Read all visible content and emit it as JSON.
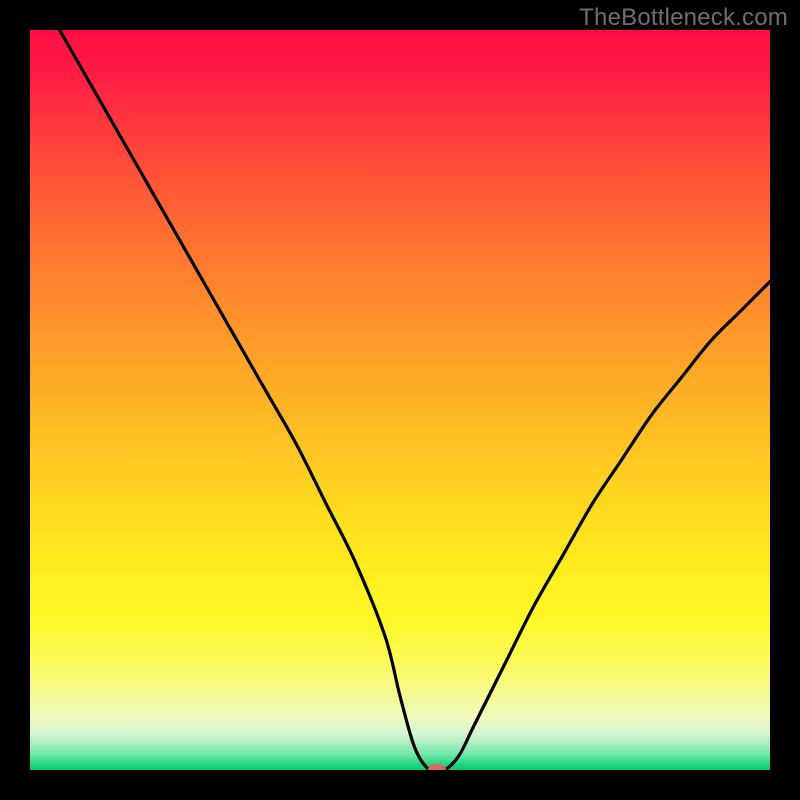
{
  "watermark": "TheBottleneck.com",
  "chart_data": {
    "type": "line",
    "title": "",
    "xlabel": "",
    "ylabel": "",
    "xlim": [
      0,
      100
    ],
    "ylim": [
      0,
      100
    ],
    "grid": false,
    "legend": false,
    "background": "rainbow-gradient",
    "series": [
      {
        "name": "bottleneck-curve",
        "x": [
          4,
          8,
          12,
          16,
          20,
          24,
          28,
          32,
          36,
          40,
          44,
          48,
          50,
          52,
          54,
          56,
          58,
          60,
          64,
          68,
          72,
          76,
          80,
          84,
          88,
          92,
          96,
          100
        ],
        "y": [
          100,
          93,
          86,
          79,
          72,
          65,
          58,
          51,
          44,
          36,
          28,
          18,
          10,
          3,
          0,
          0,
          2,
          6,
          14,
          22,
          29,
          36,
          42,
          48,
          53,
          58,
          62,
          66
        ]
      }
    ],
    "marker": {
      "x": 55,
      "y": 0,
      "color": "#d56a5e"
    }
  }
}
